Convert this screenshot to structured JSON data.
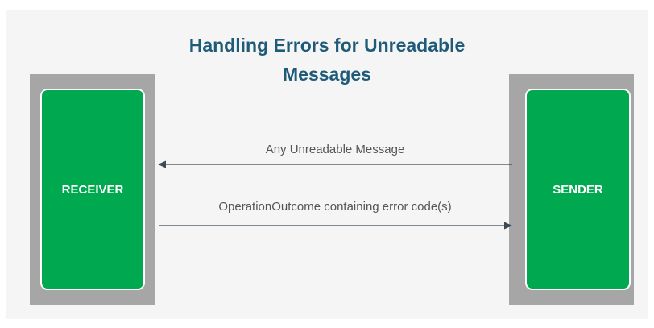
{
  "diagram": {
    "title_line1": "Handling Errors for Unreadable",
    "title_line2": "Messages",
    "receiver_label": "RECEIVER",
    "sender_label": "SENDER",
    "message_top": "Any Unreadable Message",
    "message_bottom": "OperationOutcome containing error code(s)"
  },
  "colors": {
    "title": "#1f5b78",
    "box_fill": "#00a84f",
    "frame": "#a6a6a6",
    "arrow": "#3b4a55",
    "background": "#f5f5f5"
  }
}
